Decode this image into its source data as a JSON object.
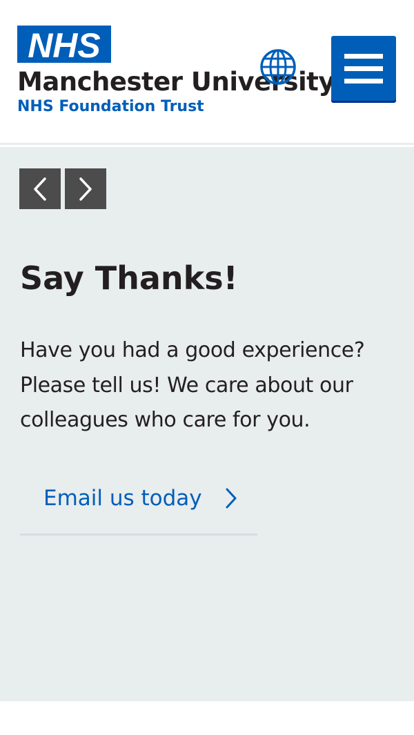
{
  "header": {
    "logo_text": "NHS",
    "organisation_name": "Manchester University",
    "organisation_subtitle": "NHS Foundation Trust",
    "globe_icon": "globe-icon",
    "menu_icon": "hamburger-menu-icon"
  },
  "carousel": {
    "prev_icon": "chevron-left-icon",
    "next_icon": "chevron-right-icon"
  },
  "main": {
    "heading": "Say Thanks!",
    "body": "Have you had a good experience? Please tell us! We care about our colleagues who care for you.",
    "cta_label": "Email us today",
    "cta_icon": "chevron-right-icon"
  },
  "colors": {
    "nhs_blue": "#005eb8",
    "text": "#231f20",
    "panel_background": "#e8edee",
    "carousel_button": "#4c4c4c"
  }
}
